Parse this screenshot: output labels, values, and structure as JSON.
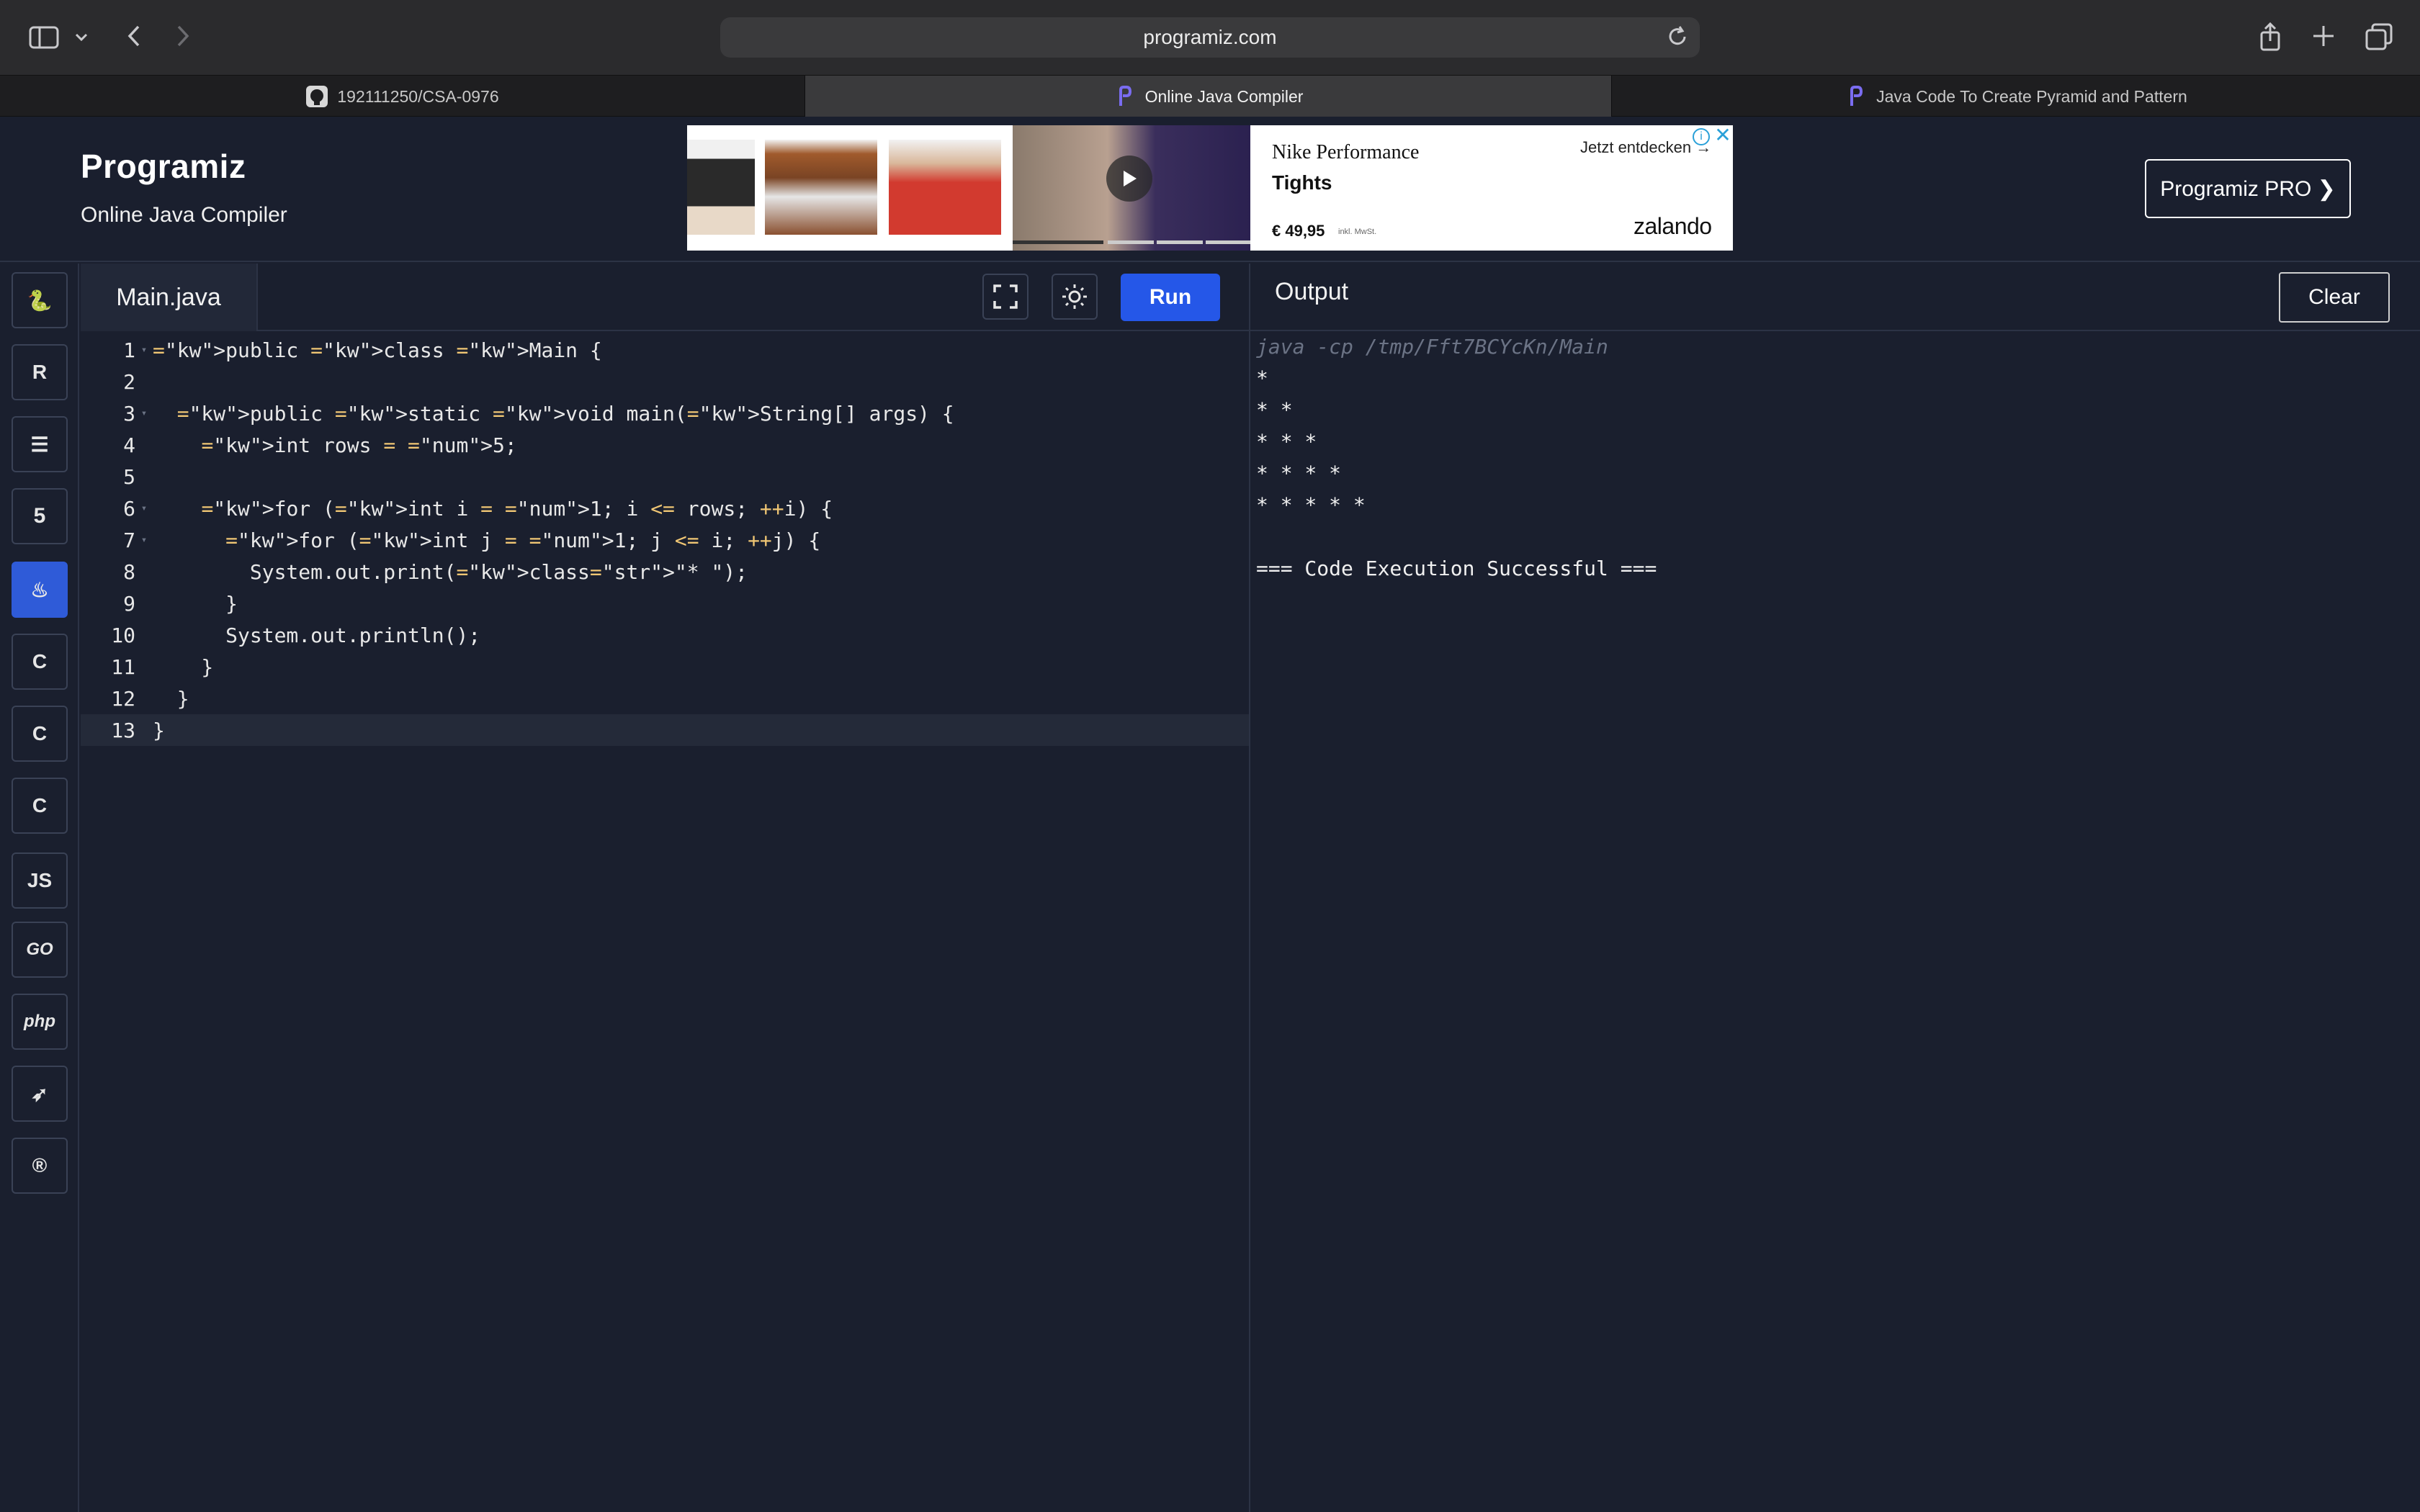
{
  "browser": {
    "url": "programiz.com",
    "tabs": [
      {
        "label": "192111250/CSA-0976",
        "active": false
      },
      {
        "label": "Online Java Compiler",
        "active": true
      },
      {
        "label": "Java Code To Create Pyramid and Pattern",
        "active": false
      }
    ]
  },
  "header": {
    "logo": "Programiz",
    "subtitle": "Online Java Compiler",
    "pro_button": "Programiz PRO ❯"
  },
  "ad": {
    "title": "Nike Performance",
    "product": "Tights",
    "price": "€ 49,95",
    "price_note": "inkl. MwSt.",
    "cta": "Jetzt entdecken →",
    "brand": "zalando"
  },
  "languages": [
    {
      "icon": "python-icon",
      "glyph": "🐍"
    },
    {
      "icon": "r-icon",
      "glyph": "R"
    },
    {
      "icon": "sql-icon",
      "glyph": "☰"
    },
    {
      "icon": "html-icon",
      "glyph": "5"
    },
    {
      "icon": "java-icon",
      "glyph": "♨",
      "active": true
    },
    {
      "icon": "c-icon",
      "glyph": "C"
    },
    {
      "icon": "cpp-icon",
      "glyph": "C"
    },
    {
      "icon": "csharp-icon",
      "glyph": "C"
    },
    {
      "icon": "javascript-icon",
      "glyph": "JS"
    },
    {
      "icon": "go-icon",
      "glyph": "GO"
    },
    {
      "icon": "php-icon",
      "glyph": "php"
    },
    {
      "icon": "swift-icon",
      "glyph": "➶"
    },
    {
      "icon": "rust-icon",
      "glyph": "®"
    }
  ],
  "editor": {
    "filename": "Main.java",
    "run_label": "Run",
    "lines": [
      "public class Main {",
      "",
      "  public static void main(String[] args) {",
      "    int rows = 5;",
      "",
      "    for (int i = 1; i <= rows; ++i) {",
      "      for (int j = 1; j <= i; ++j) {",
      "        System.out.print(\"* \");",
      "      }",
      "      System.out.println();",
      "    }",
      "  }",
      "}"
    ]
  },
  "output": {
    "title": "Output",
    "clear_label": "Clear",
    "command": "java -cp /tmp/Fft7BCYcKn/Main",
    "lines": [
      "*",
      "* *",
      "* * *",
      "* * * *",
      "* * * * *",
      "",
      "=== Code Execution Successful ==="
    ]
  }
}
